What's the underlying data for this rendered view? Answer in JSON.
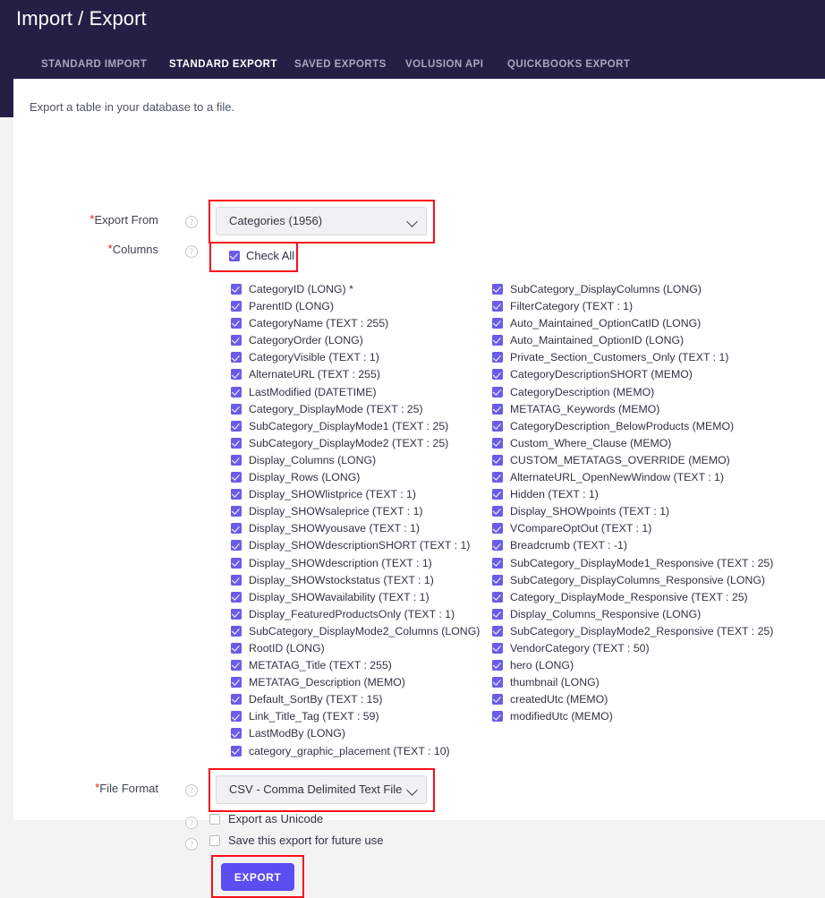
{
  "header": {
    "title": "Import / Export",
    "tabs": [
      {
        "id": "standard-import",
        "label": "STANDARD IMPORT",
        "active": false
      },
      {
        "id": "standard-export",
        "label": "STANDARD EXPORT",
        "active": true
      },
      {
        "id": "saved-exports",
        "label": "SAVED EXPORTS",
        "active": false
      },
      {
        "id": "volusion-api",
        "label": "VOLUSION API",
        "active": false
      },
      {
        "id": "quickbooks-export",
        "label": "QUICKBOOKS EXPORT",
        "active": false
      }
    ],
    "active_tab_underline_color": "#29abe2",
    "background_color": "#232046"
  },
  "main": {
    "intro": "Export a table in your database to a file.",
    "export_from": {
      "label": "Export From",
      "required_marker": "*",
      "help_icon": "question-mark-icon",
      "selected_value": "Categories (1956)"
    },
    "columns": {
      "label": "Columns",
      "required_marker": "*",
      "help_icon": "question-mark-icon",
      "check_all_label": "Check All",
      "check_all_checked": true,
      "left": [
        "CategoryID (LONG) *",
        "ParentID (LONG)",
        "CategoryName (TEXT : 255)",
        "CategoryOrder (LONG)",
        "CategoryVisible (TEXT : 1)",
        "AlternateURL (TEXT : 255)",
        "LastModified (DATETIME)",
        "Category_DisplayMode (TEXT : 25)",
        "SubCategory_DisplayMode1 (TEXT : 25)",
        "SubCategory_DisplayMode2 (TEXT : 25)",
        "Display_Columns (LONG)",
        "Display_Rows (LONG)",
        "Display_SHOWlistprice (TEXT : 1)",
        "Display_SHOWsaleprice (TEXT : 1)",
        "Display_SHOWyousave (TEXT : 1)",
        "Display_SHOWdescriptionSHORT (TEXT : 1)",
        "Display_SHOWdescription (TEXT : 1)",
        "Display_SHOWstockstatus (TEXT : 1)",
        "Display_SHOWavailability (TEXT : 1)",
        "Display_FeaturedProductsOnly (TEXT : 1)",
        "SubCategory_DisplayMode2_Columns (LONG)",
        "RootID (LONG)",
        "METATAG_Title (TEXT : 255)",
        "METATAG_Description (MEMO)",
        "Default_SortBy (TEXT : 15)",
        "Link_Title_Tag (TEXT : 59)",
        "LastModBy (LONG)",
        "category_graphic_placement (TEXT : 10)"
      ],
      "right": [
        "SubCategory_DisplayColumns (LONG)",
        "FilterCategory (TEXT : 1)",
        "Auto_Maintained_OptionCatID (LONG)",
        "Auto_Maintained_OptionID (LONG)",
        "Private_Section_Customers_Only (TEXT : 1)",
        "CategoryDescriptionSHORT (MEMO)",
        "CategoryDescription (MEMO)",
        "METATAG_Keywords (MEMO)",
        "CategoryDescription_BelowProducts (MEMO)",
        "Custom_Where_Clause (MEMO)",
        "CUSTOM_METATAGS_OVERRIDE (MEMO)",
        "AlternateURL_OpenNewWindow (TEXT : 1)",
        "Hidden (TEXT : 1)",
        "Display_SHOWpoints (TEXT : 1)",
        "VCompareOptOut (TEXT : 1)",
        "Breadcrumb (TEXT : -1)",
        "SubCategory_DisplayMode1_Responsive (TEXT : 25)",
        "SubCategory_DisplayColumns_Responsive (LONG)",
        "Category_DisplayMode_Responsive (TEXT : 25)",
        "Display_Columns_Responsive (LONG)",
        "SubCategory_DisplayMode2_Responsive (TEXT : 25)",
        "VendorCategory (TEXT : 50)",
        "hero (LONG)",
        "thumbnail (LONG)",
        "createdUtc (MEMO)",
        "modifiedUtc (MEMO)"
      ]
    },
    "file_format": {
      "label": "File Format",
      "required_marker": "*",
      "help_icon": "question-mark-icon",
      "selected_value": "CSV - Comma Delimited Text File"
    },
    "export_unicode": {
      "label": "Export as Unicode",
      "checked": false,
      "help_icon": "question-mark-icon"
    },
    "save_export": {
      "label": "Save this export for future use",
      "checked": false,
      "help_icon": "question-mark-icon"
    },
    "export_button": {
      "label": "EXPORT",
      "color": "#5c4df0"
    }
  },
  "annotations": {
    "highlight_color": "#fc0d1b",
    "note": "red rectangles drawn around Export From select, Check All, File Format select and Export button"
  }
}
